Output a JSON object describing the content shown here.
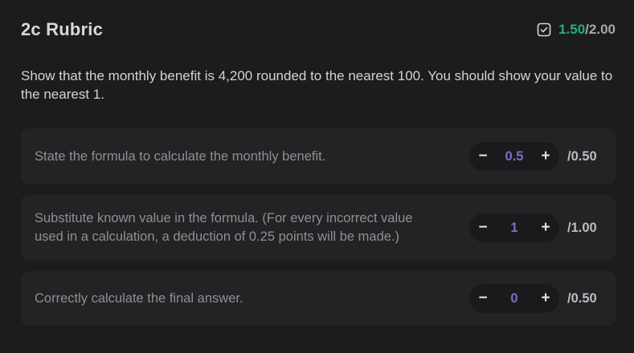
{
  "header": {
    "title": "2c Rubric",
    "score_earned": "1.50",
    "score_separator": "/",
    "score_total": "2.00",
    "check_icon": "checkbox-checked-icon"
  },
  "question": "Show that the monthly benefit is 4,200 rounded to the nearest 100. You should show your value to the nearest 1.",
  "criteria": [
    {
      "text": "State the formula to calculate the monthly benefit.",
      "value": "0.5",
      "max": "/0.50",
      "minus": "−",
      "plus": "+"
    },
    {
      "text": "Substitute known value in the formula. (For every incorrect value used in a calculation, a deduction of 0.25 points will be made.)",
      "value": "1",
      "max": "/1.00",
      "minus": "−",
      "plus": "+"
    },
    {
      "text": "Correctly calculate the final answer.",
      "value": "0",
      "max": "/0.50",
      "minus": "−",
      "plus": "+"
    }
  ],
  "colors": {
    "background": "#1c1c1e",
    "card": "#232325",
    "earned": "#22b07d",
    "stepper_value": "#7b6fc4"
  }
}
